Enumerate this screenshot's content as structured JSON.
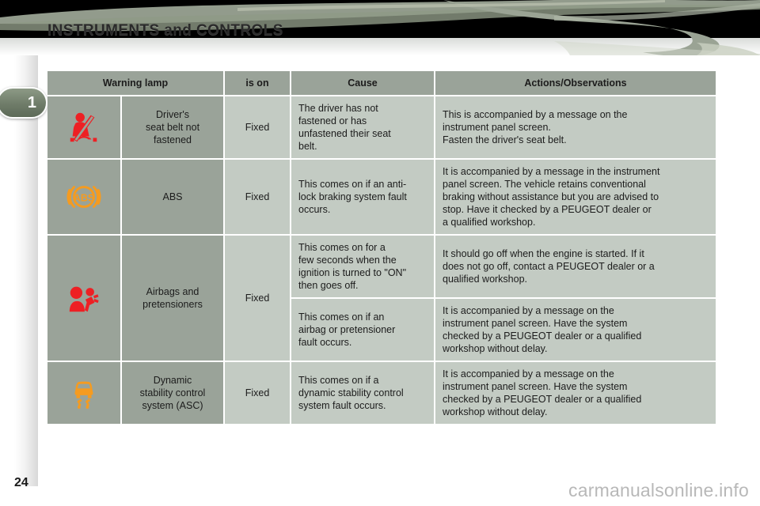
{
  "document": {
    "chapter_number": "1",
    "section_title": "INSTRUMENTS and CONTROLS",
    "page_number": "24",
    "watermark": "carmanualsonline.info"
  },
  "colors": {
    "header_band": "#000000",
    "swoosh": "#9aa394",
    "table_header_bg": "#9aa399",
    "cell_dark_bg": "#9aa399",
    "cell_light_bg": "#c3cbc3",
    "icon_red": "#ed2024",
    "icon_orange": "#f59b20",
    "chapter_tab": "#6f7c69"
  },
  "table": {
    "columns": [
      {
        "label": "Warning lamp",
        "span": 2
      },
      {
        "label": "is on",
        "span": 1
      },
      {
        "label": "Cause",
        "span": 1
      },
      {
        "label": "Actions/Observations",
        "span": 1
      }
    ],
    "rows": [
      {
        "icon": "seatbelt-unfastened-icon",
        "name": [
          "Driver's",
          "seat belt not",
          "fastened"
        ],
        "is_on": "Fixed",
        "entries": [
          {
            "cause": [
              "The driver has not",
              "fastened or has",
              "unfastened their seat",
              "belt."
            ],
            "actions": [
              "This is accompanied by a message on the",
              "instrument panel screen.",
              "Fasten the driver's seat belt."
            ]
          }
        ]
      },
      {
        "icon": "abs-icon",
        "name": [
          "ABS"
        ],
        "is_on": "Fixed",
        "entries": [
          {
            "cause": [
              "This comes on if an anti-",
              "lock braking system fault",
              "occurs."
            ],
            "actions": [
              "It is accompanied by a message in the instrument",
              "panel screen. The vehicle retains conventional",
              "braking without assistance but you are advised to",
              "stop. Have it checked by a PEUGEOT dealer or",
              "a qualified workshop."
            ]
          }
        ]
      },
      {
        "icon": "airbag-icon",
        "name": [
          "Airbags and",
          "pretensioners"
        ],
        "is_on": "Fixed",
        "entries": [
          {
            "cause": [
              "This comes on for a",
              "few seconds when the",
              "ignition is turned to \"ON\"",
              "then goes off."
            ],
            "actions": [
              "It should go off when the engine is started. If it",
              "does not go off, contact a PEUGEOT dealer or a",
              "qualified workshop."
            ]
          },
          {
            "cause": [
              "This comes on if an",
              "airbag or pretensioner",
              "fault occurs."
            ],
            "actions": [
              "It is accompanied by a message on the",
              "instrument panel screen. Have the system",
              "checked by a PEUGEOT dealer or a qualified",
              "workshop without delay."
            ]
          }
        ]
      },
      {
        "icon": "asc-skid-icon",
        "name": [
          "Dynamic",
          "stability control",
          "system (ASC)"
        ],
        "is_on": "Fixed",
        "entries": [
          {
            "cause": [
              "This comes on if a",
              "dynamic stability control",
              "system fault occurs."
            ],
            "actions": [
              "It is accompanied by a message on the",
              "instrument panel screen. Have the system",
              "checked by a PEUGEOT dealer or a qualified",
              "workshop without delay."
            ]
          }
        ]
      }
    ]
  }
}
